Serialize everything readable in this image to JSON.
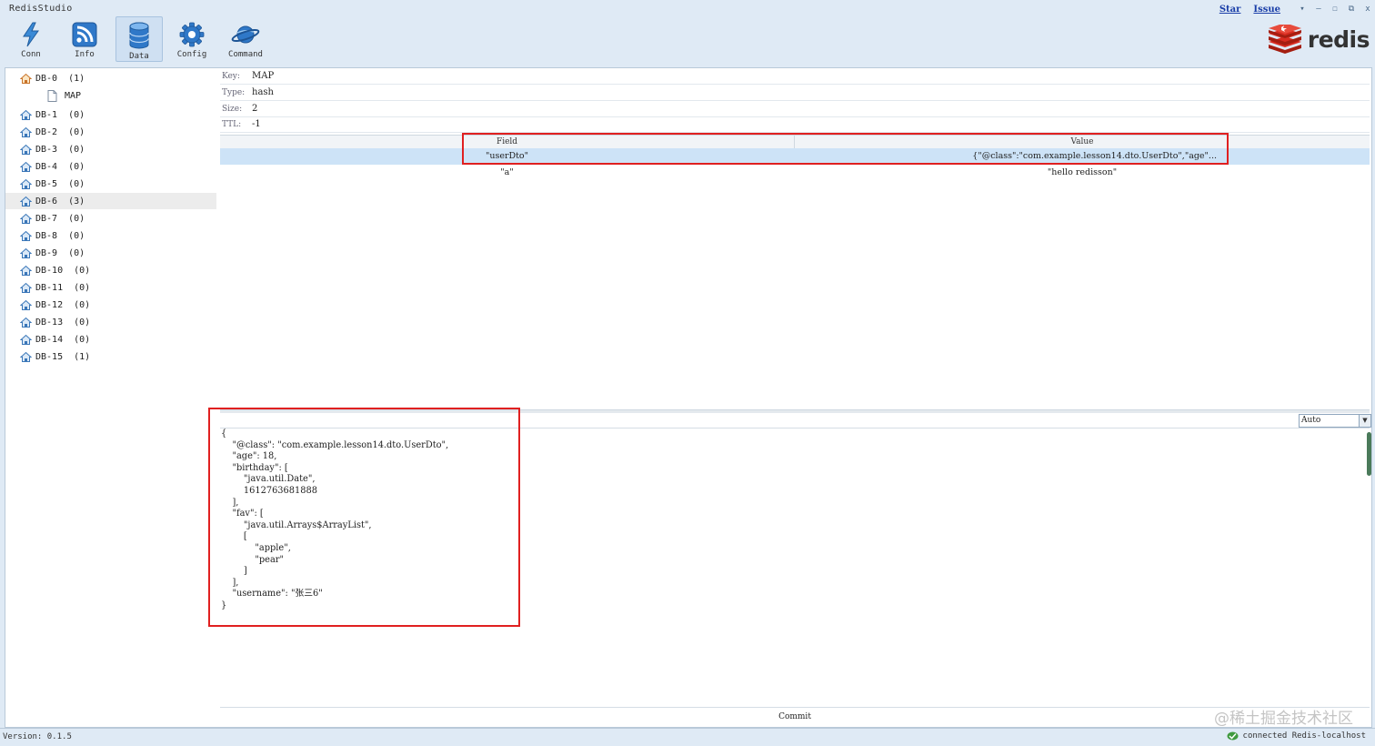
{
  "app": {
    "title": "RedisStudio"
  },
  "top_links": {
    "star": "Star",
    "issue": "Issue"
  },
  "window_controls": {
    "menu": "▾",
    "minimize": "—",
    "maximize": "☐",
    "restore": "⧉",
    "close": "x"
  },
  "toolbar": [
    {
      "label": "Conn",
      "icon": "lightning-icon",
      "active": false
    },
    {
      "label": "Info",
      "icon": "rss-icon",
      "active": false
    },
    {
      "label": "Data",
      "icon": "database-icon",
      "active": true
    },
    {
      "label": "Config",
      "icon": "gear-icon",
      "active": false
    },
    {
      "label": "Command",
      "icon": "planet-icon",
      "active": false
    }
  ],
  "logo": {
    "word": "redis",
    "color": "#d82c20"
  },
  "tree": [
    {
      "label": "DB-0  (1)",
      "expanded": true,
      "children": [
        {
          "label": "MAP"
        }
      ]
    },
    {
      "label": "DB-1  (0)"
    },
    {
      "label": "DB-2  (0)"
    },
    {
      "label": "DB-3  (0)"
    },
    {
      "label": "DB-4  (0)"
    },
    {
      "label": "DB-5  (0)"
    },
    {
      "label": "DB-6  (3)",
      "highlighted": true
    },
    {
      "label": "DB-7  (0)"
    },
    {
      "label": "DB-8  (0)"
    },
    {
      "label": "DB-9  (0)"
    },
    {
      "label": "DB-10  (0)"
    },
    {
      "label": "DB-11  (0)"
    },
    {
      "label": "DB-12  (0)"
    },
    {
      "label": "DB-13  (0)"
    },
    {
      "label": "DB-14  (0)"
    },
    {
      "label": "DB-15  (1)"
    }
  ],
  "key_info": {
    "key_label": "Key:",
    "key_value": "MAP",
    "type_label": "Type:",
    "type_value": "hash",
    "size_label": "Size:",
    "size_value": "2",
    "ttl_label": "TTL:",
    "ttl_value": "-1"
  },
  "grid": {
    "headers": [
      "Field",
      "Value"
    ],
    "rows": [
      {
        "field": "\"userDto\"",
        "value": "{\"@class\":\"com.example.lesson14.dto.UserDto\",\"age\"...",
        "selected": true
      },
      {
        "field": "\"a\"",
        "value": "\"hello redisson\"",
        "selected": false
      }
    ]
  },
  "format": {
    "selected": "Auto"
  },
  "editor_text": "{\n    \"@class\": \"com.example.lesson14.dto.UserDto\",\n    \"age\": 18,\n    \"birthday\": [\n        \"java.util.Date\",\n        1612763681888\n    ],\n    \"fav\": [\n        \"java.util.Arrays$ArrayList\",\n        [\n            \"apple\",\n            \"pear\"\n        ]\n    ],\n    \"username\": \"张三6\"\n}",
  "commit_label": "Commit",
  "watermark": "@稀土掘金技术社区",
  "status": {
    "version": "Version: 0.1.5",
    "connection": "connected Redis-localhost"
  },
  "colors": {
    "highlight_box": "#e02020",
    "selected_row": "#cde3f7",
    "background": "#dfeaf5"
  }
}
